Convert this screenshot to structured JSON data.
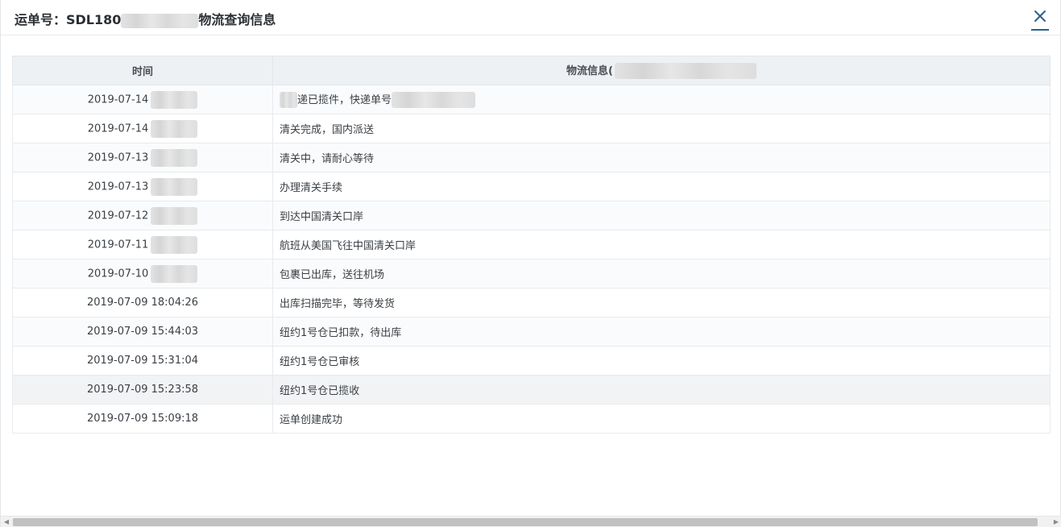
{
  "dialog": {
    "title_prefix": "运单号：SDL180",
    "title_suffix": "物流查询信息",
    "close_icon": "close-icon"
  },
  "table": {
    "headers": {
      "time": "时间",
      "info": "物流信息("
    },
    "rows": [
      {
        "time": "2019-07-14",
        "time_redacted": true,
        "info": "递已揽件，快递单号",
        "info_prefix_redacted": true,
        "info_suffix_redacted": true
      },
      {
        "time": "2019-07-14",
        "time_redacted": true,
        "info": "清关完成，国内派送"
      },
      {
        "time": "2019-07-13",
        "time_redacted": true,
        "info": "清关中，请耐心等待"
      },
      {
        "time": "2019-07-13",
        "time_redacted": true,
        "info": "办理清关手续"
      },
      {
        "time": "2019-07-12",
        "time_redacted": true,
        "info": "到达中国清关口岸"
      },
      {
        "time": "2019-07-11",
        "time_redacted": true,
        "info": "航班从美国飞往中国清关口岸"
      },
      {
        "time": "2019-07-10",
        "time_redacted": true,
        "info": "包裹已出库，送往机场"
      },
      {
        "time": "2019-07-09 18:04:26",
        "info": "出库扫描完毕，等待发货"
      },
      {
        "time": "2019-07-09 15:44:03",
        "info": "纽约1号仓已扣款，待出库"
      },
      {
        "time": "2019-07-09 15:31:04",
        "info": "纽约1号仓已审核"
      },
      {
        "time": "2019-07-09 15:23:58",
        "info": "纽约1号仓已揽收",
        "hovered": true
      },
      {
        "time": "2019-07-09 15:09:18",
        "info": "运单创建成功"
      }
    ]
  },
  "scrollbar": {
    "left_arrow": "◀",
    "right_arrow": "▶"
  },
  "colors": {
    "header_bg": "#eef1f4",
    "close_accent": "#2d5f8f"
  }
}
